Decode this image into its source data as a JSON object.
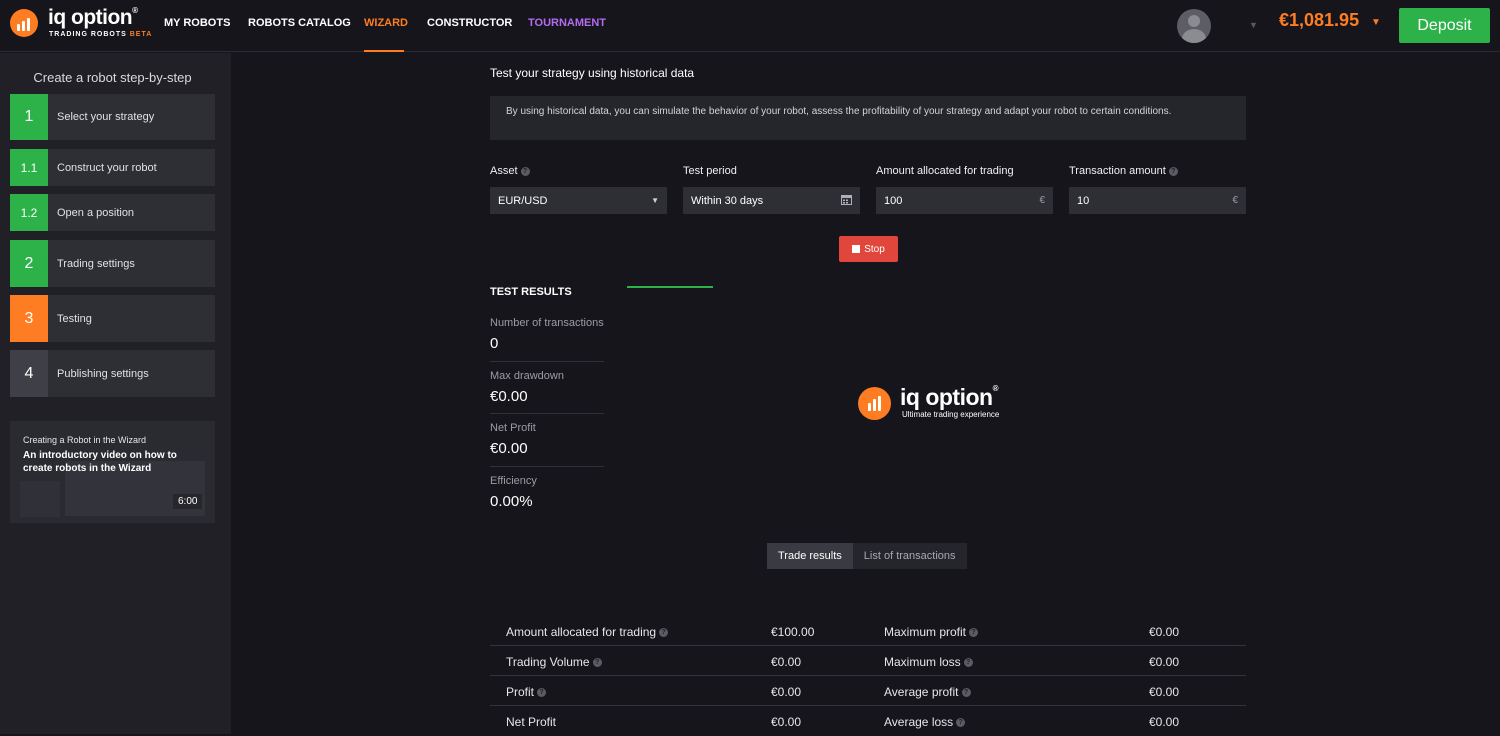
{
  "logo": {
    "name": "iq option",
    "registered": "®",
    "tagline": "TRADING ROBOTS",
    "beta": "BETA"
  },
  "nav": [
    {
      "label": "MY ROBOTS"
    },
    {
      "label": "ROBOTS CATALOG"
    },
    {
      "label": "WIZARD"
    },
    {
      "label": "CONSTRUCTOR"
    },
    {
      "label": "TOURNAMENT"
    }
  ],
  "header": {
    "balance": "€1,081.95",
    "deposit_label": "Deposit"
  },
  "sidebar": {
    "title": "Create a robot step-by-step",
    "steps": [
      {
        "num": "1",
        "label": "Select your strategy",
        "status": "done"
      },
      {
        "num": "1.1",
        "label": "Construct your robot",
        "status": "done"
      },
      {
        "num": "1.2",
        "label": "Open a position",
        "status": "done"
      },
      {
        "num": "2",
        "label": "Trading settings",
        "status": "done"
      },
      {
        "num": "3",
        "label": "Testing",
        "status": "current"
      },
      {
        "num": "4",
        "label": "Publishing settings",
        "status": "pending"
      }
    ],
    "video": {
      "small_title": "Creating a Robot in the Wizard",
      "title": "An introductory video on how to create robots in the Wizard",
      "duration": "6:00"
    }
  },
  "main": {
    "title": "Test your strategy using historical data",
    "info": "By using historical data, you can simulate the behavior of your robot, assess the profitability of your strategy and adapt your robot to certain conditions.",
    "fields": {
      "asset": {
        "label": "Asset",
        "value": "EUR/USD"
      },
      "period": {
        "label": "Test period",
        "value": "Within 30 days"
      },
      "allocated": {
        "label": "Amount allocated for trading",
        "value": "100",
        "suffix": "€"
      },
      "transaction": {
        "label": "Transaction amount",
        "value": "10",
        "suffix": "€"
      }
    },
    "stop_label": "Stop"
  },
  "results": {
    "title": "TEST RESULTS",
    "metrics": [
      {
        "label": "Number of transactions",
        "value": "0"
      },
      {
        "label": "Max drawdown",
        "value": "€0.00"
      },
      {
        "label": "Net Profit",
        "value": "€0.00"
      },
      {
        "label": "Efficiency",
        "value": "0.00%"
      }
    ],
    "center_logo": {
      "name": "iq option",
      "registered": "®",
      "tagline": "Ultimate trading experience"
    },
    "tabs": [
      {
        "label": "Trade results"
      },
      {
        "label": "List of transactions"
      }
    ],
    "table": [
      {
        "l1": "Amount allocated for trading",
        "v1": "€100.00",
        "l2": "Maximum profit",
        "v2": "€0.00"
      },
      {
        "l1": "Trading Volume",
        "v1": "€0.00",
        "l2": "Maximum loss",
        "v2": "€0.00"
      },
      {
        "l1": "Profit",
        "v1": "€0.00",
        "l2": "Average profit",
        "v2": "€0.00"
      },
      {
        "l1": "Net Profit",
        "v1": "€0.00",
        "l2": "Average loss",
        "v2": "€0.00"
      }
    ]
  },
  "colors": {
    "accent": "#ff7d22",
    "success": "#2db24a",
    "danger": "#e0463b",
    "tournament": "#b36cf0"
  }
}
